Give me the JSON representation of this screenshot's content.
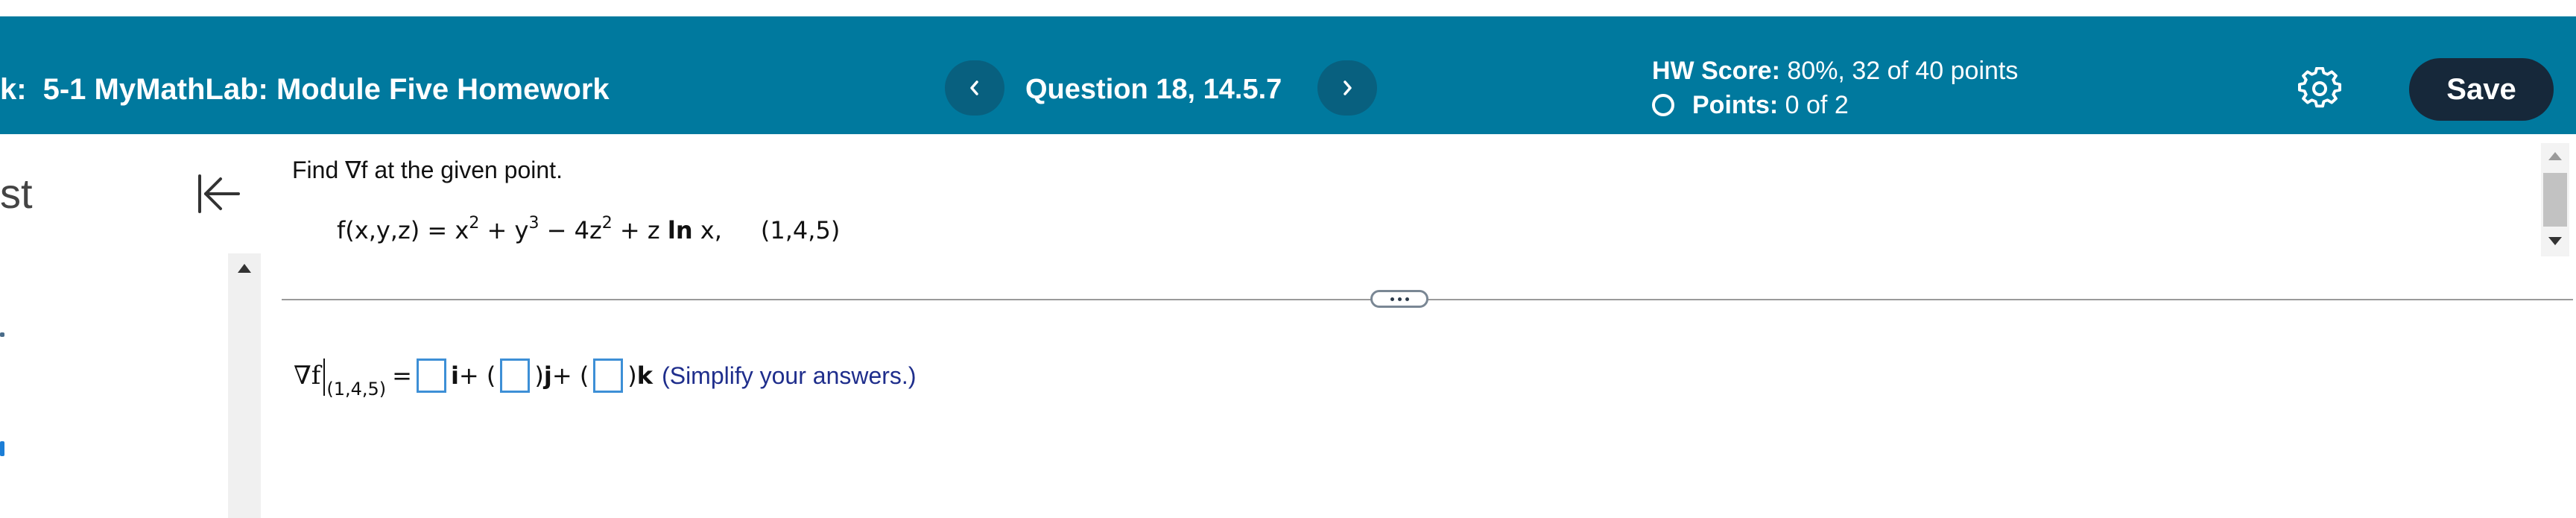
{
  "header": {
    "title_prefix": "k:",
    "title": "5-1 MyMathLab: Module Five Homework",
    "question_label": "Question 18, 14.5.7",
    "hw_score_label": "HW Score:",
    "hw_score_value": "80%, 32 of 40 points",
    "points_label": "Points:",
    "points_value": "0 of 2",
    "save_label": "Save",
    "icons": {
      "prev": "chevron-left-icon",
      "next": "chevron-right-icon",
      "settings": "gear-icon",
      "status": "empty-circle-icon"
    }
  },
  "left_panel": {
    "fragment": "st",
    "icons": {
      "collapse": "collapse-left-icon"
    }
  },
  "question": {
    "prompt": "Find ∇f at the given point.",
    "func_lhs": "f(x,y,z) = x",
    "exp_x": "2",
    "plus_y": " + y",
    "exp_y": "3",
    "minus_z": " − 4z",
    "exp_z": "2",
    "plus_z": " + z ",
    "ln": "ln",
    "x_end": " x,",
    "point": "(1,4,5)"
  },
  "answer": {
    "grad": "∇f",
    "subscript": "(1,4,5)",
    "eq": " = ",
    "i": "i",
    "plus_open_1": " + (",
    "close_j": ")",
    "j": "j",
    "plus_open_2": " + (",
    "close_k": ")",
    "k": "k",
    "hint": "(Simplify your answers.)"
  },
  "colors": {
    "header_bg": "#00799e",
    "nav_button_bg": "#08607f",
    "save_button_bg": "#16283a",
    "input_border": "#3d8fd6",
    "hint_text": "#1f2e8c"
  }
}
